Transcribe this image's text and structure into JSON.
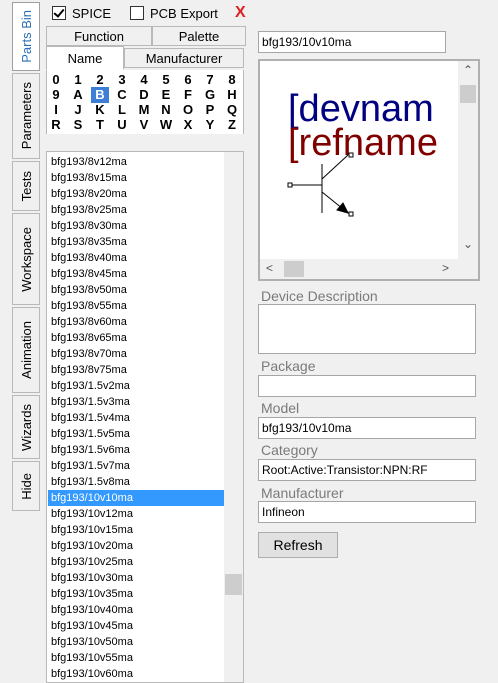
{
  "side_tabs": [
    {
      "label": "Parts Bin",
      "active": true
    },
    {
      "label": "Parameters",
      "active": false
    },
    {
      "label": "Tests",
      "active": false
    },
    {
      "label": "Workspace",
      "active": false
    },
    {
      "label": "Animation",
      "active": false
    },
    {
      "label": "Wizards",
      "active": false
    },
    {
      "label": "Hide",
      "active": false
    }
  ],
  "toolbar": {
    "spice_label": "SPICE",
    "spice_checked": true,
    "pcb_label": "PCB Export",
    "pcb_checked": false,
    "close_label": "X"
  },
  "library_tabs": {
    "row1": [
      "Function",
      "Palette"
    ],
    "row2": [
      "Name",
      "Manufacturer"
    ],
    "active": "Name"
  },
  "alphabet": {
    "rows": [
      [
        "0",
        "1",
        "2",
        "3",
        "4",
        "5",
        "6",
        "7",
        "8"
      ],
      [
        "9",
        "A",
        "B",
        "C",
        "D",
        "E",
        "F",
        "G",
        "H"
      ],
      [
        "I",
        "J",
        "K",
        "L",
        "M",
        "N",
        "O",
        "P",
        "Q"
      ],
      [
        "R",
        "S",
        "T",
        "U",
        "V",
        "W",
        "X",
        "Y",
        "Z"
      ]
    ],
    "selected": "B"
  },
  "parts_list": {
    "items": [
      "bfg193/8v12ma",
      "bfg193/8v15ma",
      "bfg193/8v20ma",
      "bfg193/8v25ma",
      "bfg193/8v30ma",
      "bfg193/8v35ma",
      "bfg193/8v40ma",
      "bfg193/8v45ma",
      "bfg193/8v50ma",
      "bfg193/8v55ma",
      "bfg193/8v60ma",
      "bfg193/8v65ma",
      "bfg193/8v70ma",
      "bfg193/8v75ma",
      "bfg193/1.5v2ma",
      "bfg193/1.5v3ma",
      "bfg193/1.5v4ma",
      "bfg193/1.5v5ma",
      "bfg193/1.5v6ma",
      "bfg193/1.5v7ma",
      "bfg193/1.5v8ma",
      "bfg193/10v10ma",
      "bfg193/10v12ma",
      "bfg193/10v15ma",
      "bfg193/10v20ma",
      "bfg193/10v25ma",
      "bfg193/10v30ma",
      "bfg193/10v35ma",
      "bfg193/10v40ma",
      "bfg193/10v45ma",
      "bfg193/10v50ma",
      "bfg193/10v55ma",
      "bfg193/10v60ma"
    ],
    "selected": "bfg193/10v10ma"
  },
  "search_value": "bfg193/10v10ma",
  "preview": {
    "devname": "[devnam",
    "refname": "[refname"
  },
  "fields": {
    "device_description_label": "Device Description",
    "device_description_value": "",
    "package_label": "Package",
    "package_value": "",
    "model_label": "Model",
    "model_value": "bfg193/10v10ma",
    "category_label": "Category",
    "category_value": "Root:Active:Transistor:NPN:RF",
    "manufacturer_label": "Manufacturer",
    "manufacturer_value": "Infineon"
  },
  "refresh_label": "Refresh",
  "colors": {
    "devname": "#000080",
    "refname": "#800000",
    "selection": "#3399ff",
    "alpha_selected": "#3d7fd6",
    "close": "#e02020"
  }
}
